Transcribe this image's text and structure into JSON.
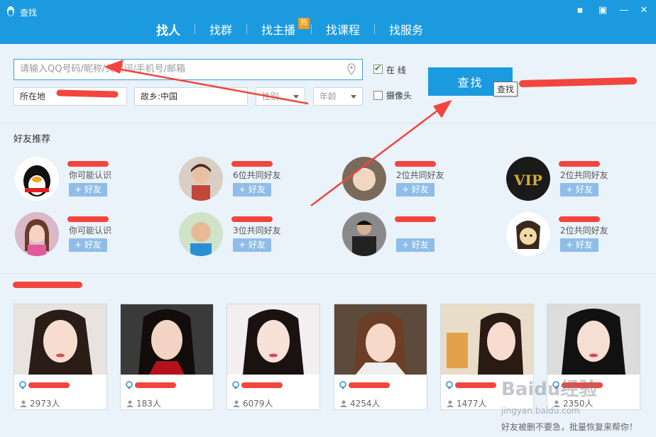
{
  "window": {
    "title": "查找"
  },
  "tabs": [
    {
      "label": "找人",
      "active": true
    },
    {
      "label": "找群"
    },
    {
      "label": "找主播",
      "badge": "热"
    },
    {
      "label": "找课程"
    },
    {
      "label": "找服务"
    }
  ],
  "search": {
    "placeholder": "请输入QQ号码/昵称/关键词/手机号/邮箱",
    "location_label": "所在地",
    "hometown": "故乡:中国",
    "gender_placeholder": "性别",
    "age_placeholder": "年龄",
    "online_label": "在 线",
    "online_checked": true,
    "camera_label": "摄像头",
    "camera_checked": false,
    "button_label": "查找",
    "tooltip": "查找"
  },
  "recommend": {
    "title": "好友推荐",
    "add_label": "+ 好友",
    "people": [
      {
        "reason": "你可能认识"
      },
      {
        "reason": "6位共同好友"
      },
      {
        "reason": "2位共同好友"
      },
      {
        "reason": "2位共同好友"
      },
      {
        "reason": "你可能认识"
      },
      {
        "reason": "3位共同好友"
      },
      {
        "reason": ""
      },
      {
        "reason": "2位共同好友"
      }
    ]
  },
  "streams": [
    {
      "viewers": "2973人"
    },
    {
      "viewers": "183人"
    },
    {
      "viewers": "6079人"
    },
    {
      "viewers": "4254人"
    },
    {
      "viewers": "1477人"
    },
    {
      "viewers": "2350人"
    }
  ],
  "watermark": {
    "logo": "Baidu经验",
    "url": "jingyan.baidu.com"
  },
  "footer": {
    "note": "好友被删不要急，批量恢复来帮你！"
  },
  "colors": {
    "brand": "#1b9ae0",
    "add_button": "#8fbde8",
    "annotation": "#f2453d"
  }
}
